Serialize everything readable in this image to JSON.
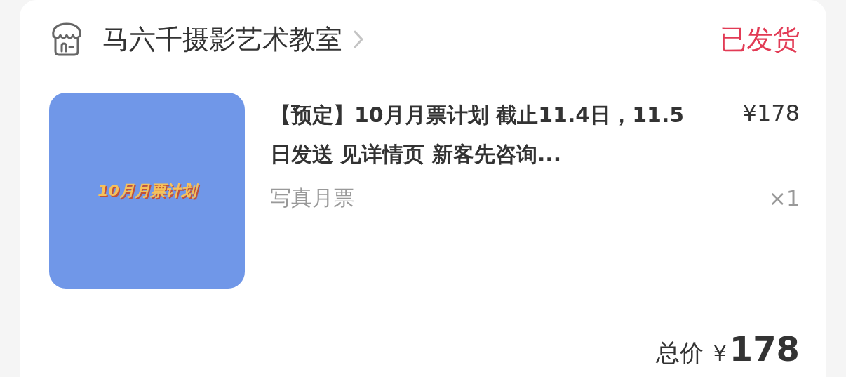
{
  "shop": {
    "name": "马六千摄影艺术教室",
    "status": "已发货"
  },
  "item": {
    "thumbnail": {
      "caption": "10月月票计划"
    },
    "title": "【预定】10月月票计划 截止11.4日，11.5日发送  见详情页 新客先咨询...",
    "price": "¥178",
    "category": "写真月票",
    "quantity": "×1"
  },
  "total": {
    "label": "总价",
    "currency": "¥",
    "amount": "178"
  }
}
